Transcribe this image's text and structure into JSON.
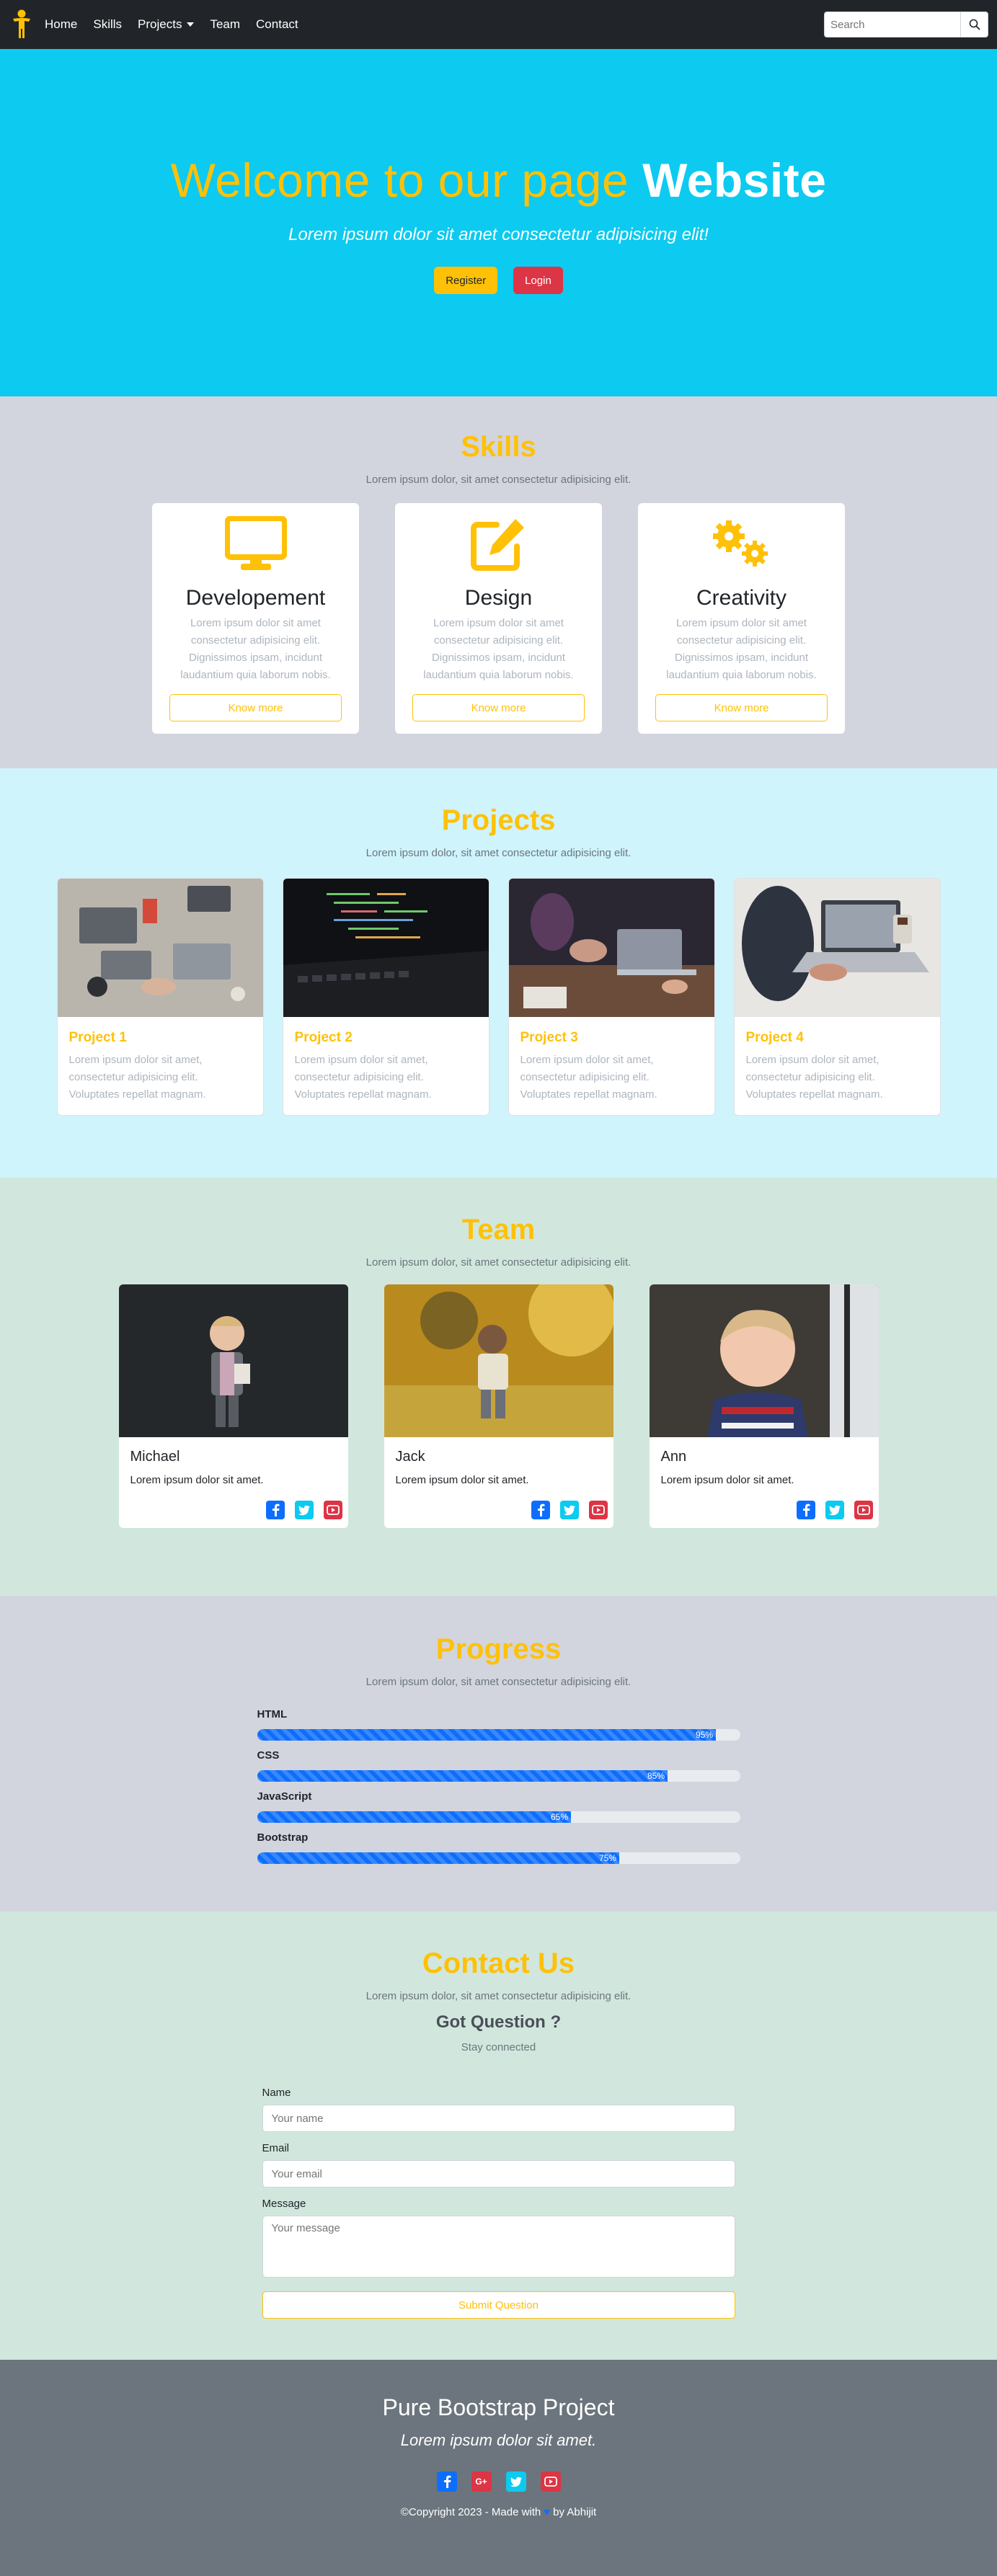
{
  "nav": {
    "links": [
      "Home",
      "Skills",
      "Projects",
      "Team",
      "Contact"
    ],
    "search_placeholder": "Search"
  },
  "hero": {
    "title_part1": "Welcome to our page",
    "title_part2": "Website",
    "subtitle": "Lorem ipsum dolor sit amet consectetur adipisicing elit!",
    "register_label": "Register",
    "login_label": "Login"
  },
  "skills": {
    "title": "Skills",
    "subtitle": "Lorem ipsum dolor, sit amet consectetur adipisicing elit.",
    "cards": [
      {
        "icon": "monitor-icon",
        "title": "Developement",
        "text": "Lorem ipsum dolor sit amet consectetur adipisicing elit. Dignissimos ipsam, incidunt laudantium quia laborum nobis.",
        "button": "Know more"
      },
      {
        "icon": "edit-icon",
        "title": "Design",
        "text": "Lorem ipsum dolor sit amet consectetur adipisicing elit. Dignissimos ipsam, incidunt laudantium quia laborum nobis.",
        "button": "Know more"
      },
      {
        "icon": "gears-icon",
        "title": "Creativity",
        "text": "Lorem ipsum dolor sit amet consectetur adipisicing elit. Dignissimos ipsam, incidunt laudantium quia laborum nobis.",
        "button": "Know more"
      }
    ]
  },
  "projects": {
    "title": "Projects",
    "subtitle": "Lorem ipsum dolor, sit amet consectetur adipisicing elit.",
    "cards": [
      {
        "title": "Project 1",
        "text": "Lorem ipsum dolor sit amet, consectetur adipisicing elit. Voluptates repellat magnam."
      },
      {
        "title": "Project 2",
        "text": "Lorem ipsum dolor sit amet, consectetur adipisicing elit. Voluptates repellat magnam."
      },
      {
        "title": "Project 3",
        "text": "Lorem ipsum dolor sit amet, consectetur adipisicing elit. Voluptates repellat magnam."
      },
      {
        "title": "Project 4",
        "text": "Lorem ipsum dolor sit amet, consectetur adipisicing elit. Voluptates repellat magnam."
      }
    ]
  },
  "team": {
    "title": "Team",
    "subtitle": "Lorem ipsum dolor, sit amet consectetur adipisicing elit.",
    "members": [
      {
        "name": "Michael",
        "text": "Lorem ipsum dolor sit amet."
      },
      {
        "name": "Jack",
        "text": "Lorem ipsum dolor sit amet."
      },
      {
        "name": "Ann",
        "text": "Lorem ipsum dolor sit amet."
      }
    ]
  },
  "progress": {
    "title": "Progress",
    "subtitle": "Lorem ipsum dolor, sit amet consectetur adipisicing elit.",
    "bars": [
      {
        "label": "HTML",
        "value": 95,
        "text": "95%"
      },
      {
        "label": "CSS",
        "value": 85,
        "text": "85%"
      },
      {
        "label": "JavaScript",
        "value": 65,
        "text": "65%"
      },
      {
        "label": "Bootstrap",
        "value": 75,
        "text": "75%"
      }
    ]
  },
  "contact": {
    "title": "Contact Us",
    "subtitle": "Lorem ipsum dolor, sit amet consectetur adipisicing elit.",
    "question": "Got Question ?",
    "stay": "Stay connected",
    "name_label": "Name",
    "name_placeholder": "Your name",
    "email_label": "Email",
    "email_placeholder": "Your email",
    "message_label": "Message",
    "message_placeholder": "Your message",
    "submit_label": "Submit Question"
  },
  "footer": {
    "title": "Pure Bootstrap Project",
    "subtitle": "Lorem ipsum dolor sit amet.",
    "copy_prefix": "©Copyright 2023 - Made with",
    "copy_suffix": "by Abhijit"
  },
  "colors": {
    "accent": "#ffc107",
    "hero": "#0dcaf0",
    "dark": "#212529",
    "danger": "#dc3545",
    "primary": "#0d6efd"
  }
}
